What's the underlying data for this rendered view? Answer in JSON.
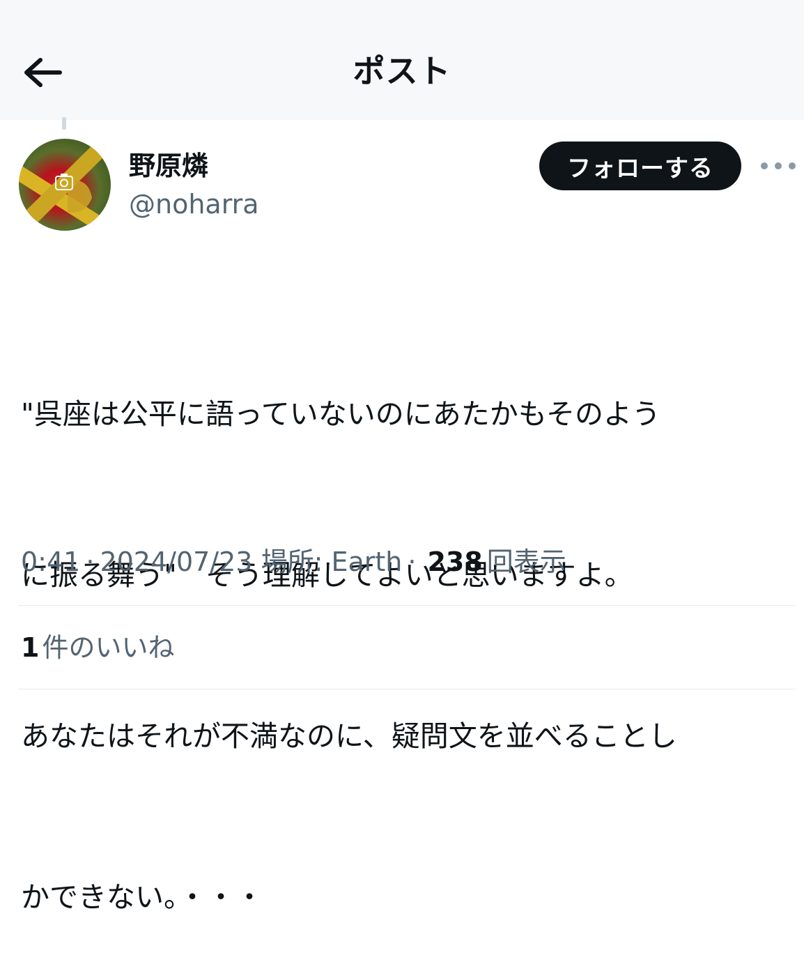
{
  "header": {
    "title": "ポスト"
  },
  "author": {
    "display_name": "野原燐",
    "handle": "@noharra"
  },
  "actions": {
    "follow_label": "フォローする"
  },
  "post": {
    "lines": [
      "\"呉座は公平に語っていないのにあたかもそのよう",
      "に振る舞う\"　そう理解してよいと思いますよ。",
      "あなたはそれが不満なのに、疑問文を並べることし",
      "かできない。・・・"
    ]
  },
  "meta": {
    "time": "0:41",
    "separator": "·",
    "date": "2024/07/23",
    "location": "場所: Earth",
    "views_count": "238",
    "views_label": "回表示"
  },
  "engagement": {
    "likes_count": "1",
    "likes_label": "件のいいね"
  },
  "colors": {
    "text_primary": "#0f1419",
    "text_secondary": "#536471",
    "header_bg": "#f7f8f9",
    "follow_button_bg": "#0f1419",
    "divider": "#e6e9ec"
  },
  "icons": {
    "back": "arrow-left-icon",
    "more": "more-horizontal-icon",
    "avatar_overlay": "camera-icon"
  }
}
